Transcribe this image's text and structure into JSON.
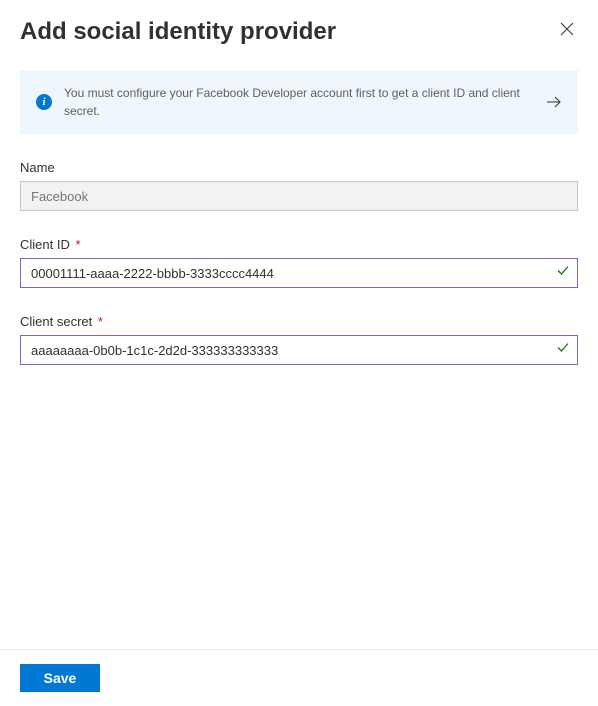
{
  "header": {
    "title": "Add social identity provider"
  },
  "info": {
    "message": "You must configure your Facebook Developer account first to get a client ID and client secret."
  },
  "fields": {
    "name": {
      "label": "Name",
      "value": "",
      "placeholder": "Facebook",
      "required": false
    },
    "clientId": {
      "label": "Client ID",
      "value": "00001111-aaaa-2222-bbbb-3333cccc4444",
      "required": true
    },
    "clientSecret": {
      "label": "Client secret",
      "value": "aaaaaaaa-0b0b-1c1c-2d2d-333333333333",
      "required": true
    }
  },
  "footer": {
    "save_label": "Save"
  },
  "required_marker": "*"
}
